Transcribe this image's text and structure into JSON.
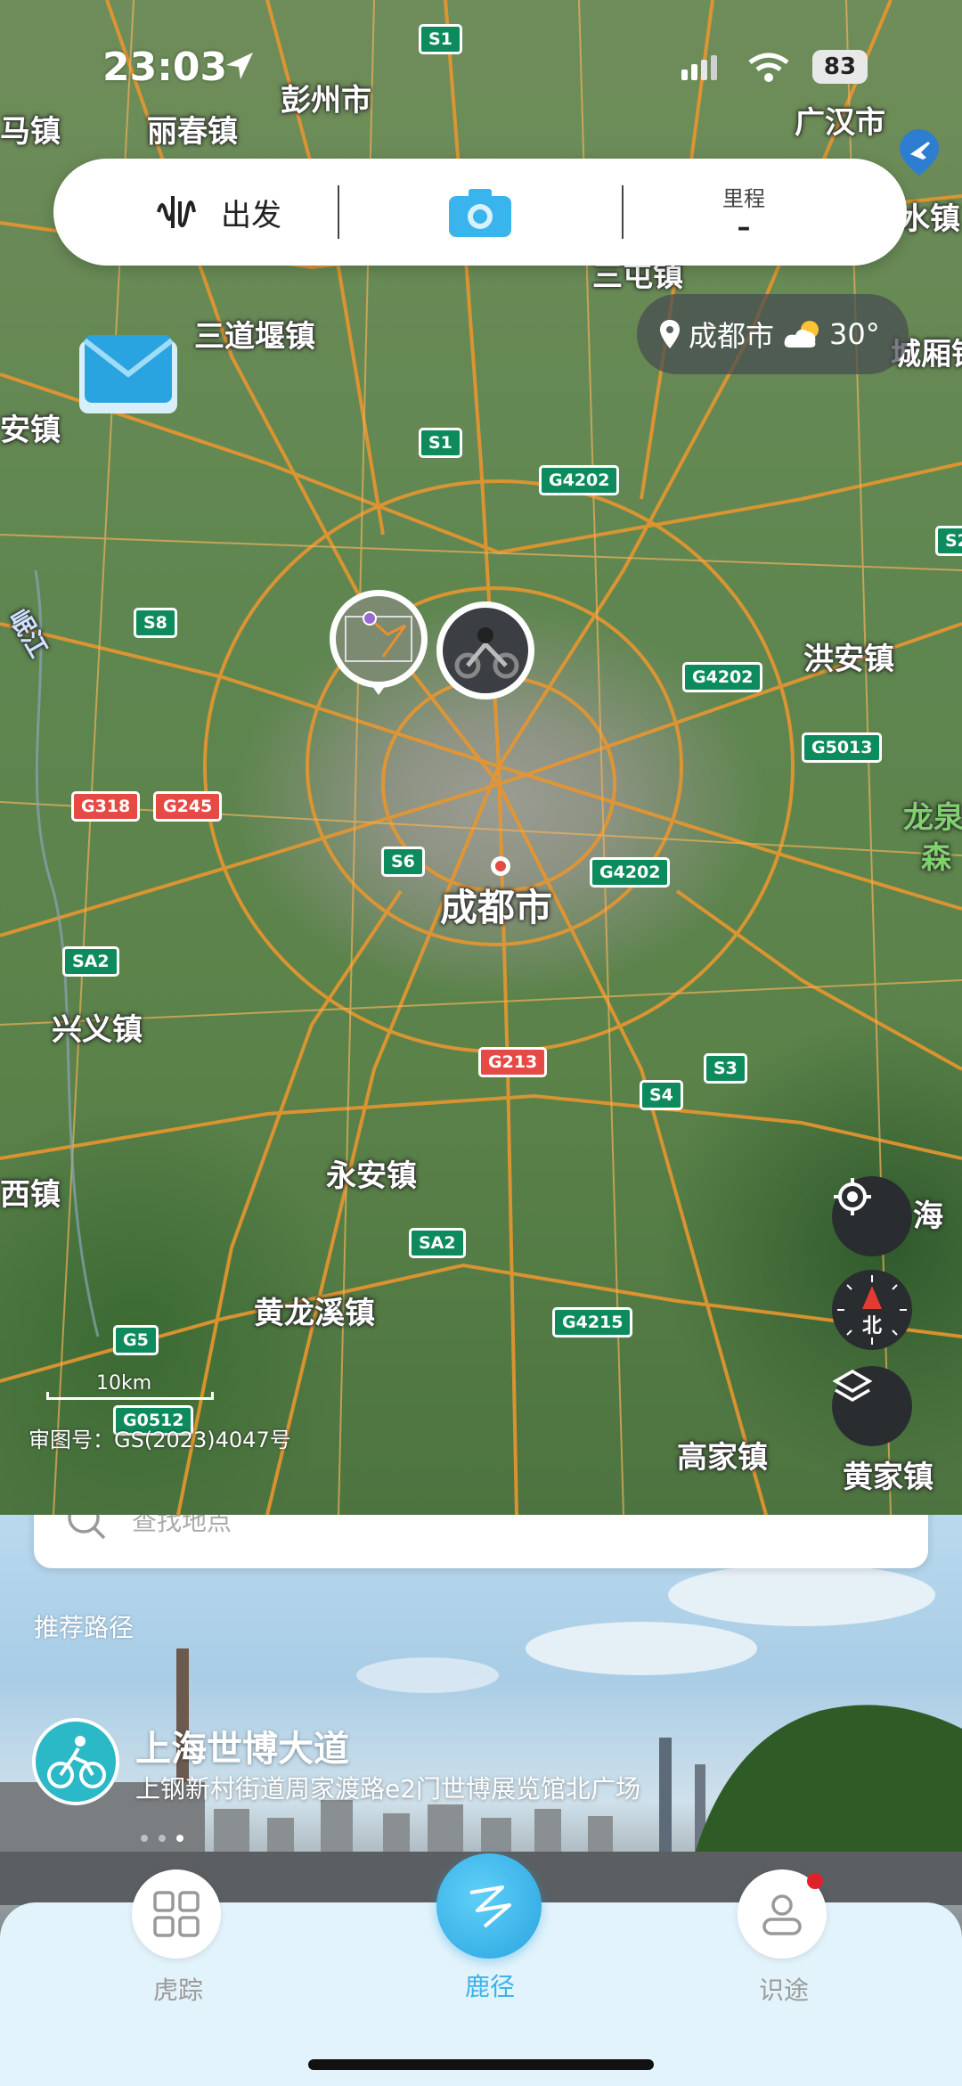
{
  "status_bar": {
    "time": "23:03",
    "battery": "83"
  },
  "top_bar": {
    "start_label": "出发",
    "mileage_label": "里程",
    "mileage_value": "–"
  },
  "weather": {
    "city": "成都市",
    "temperature": "30°"
  },
  "map": {
    "places": [
      {
        "name": "彭州市",
        "cls": ""
      },
      {
        "name": "丽春镇",
        "cls": ""
      },
      {
        "name": "马镇",
        "cls": ""
      },
      {
        "name": "广汉市",
        "cls": ""
      },
      {
        "name": "三道堰镇",
        "cls": ""
      },
      {
        "name": "安镇",
        "cls": ""
      },
      {
        "name": "城厢镇",
        "cls": ""
      },
      {
        "name": "洪安镇",
        "cls": ""
      },
      {
        "name": "成都市",
        "cls": "big"
      },
      {
        "name": "兴义镇",
        "cls": ""
      },
      {
        "name": "永安镇",
        "cls": ""
      },
      {
        "name": "黄龙溪镇",
        "cls": ""
      },
      {
        "name": "高家镇",
        "cls": ""
      },
      {
        "name": "海",
        "cls": ""
      },
      {
        "name": "西镇",
        "cls": ""
      },
      {
        "name": "龙泉",
        "cls": ""
      },
      {
        "name": "森",
        "cls": ""
      },
      {
        "name": "黄家镇",
        "cls": ""
      },
      {
        "name": "水镇",
        "cls": ""
      },
      {
        "name": "三屯镇",
        "cls": ""
      },
      {
        "name": "岷江",
        "cls": ""
      }
    ],
    "shields": [
      {
        "code": "S1",
        "color": "g"
      },
      {
        "code": "S1",
        "color": "g"
      },
      {
        "code": "G4202",
        "color": "g"
      },
      {
        "code": "S8",
        "color": "g"
      },
      {
        "code": "G4202",
        "color": "g"
      },
      {
        "code": "G5013",
        "color": "g"
      },
      {
        "code": "G318",
        "color": "r"
      },
      {
        "code": "G245",
        "color": "r"
      },
      {
        "code": "S6",
        "color": "g"
      },
      {
        "code": "G4202",
        "color": "g"
      },
      {
        "code": "SA2",
        "color": "g"
      },
      {
        "code": "G213",
        "color": "r"
      },
      {
        "code": "S3",
        "color": "g"
      },
      {
        "code": "S4",
        "color": "g"
      },
      {
        "code": "SA2",
        "color": "g"
      },
      {
        "code": "G4215",
        "color": "g"
      },
      {
        "code": "G5",
        "color": "g"
      },
      {
        "code": "G0512",
        "color": "g"
      },
      {
        "code": "S2",
        "color": "g"
      }
    ],
    "scale_label": "10km",
    "approval_number": "审图号：GS(2023)4047号",
    "compass_label": "北"
  },
  "search": {
    "placeholder": "查找地点"
  },
  "recommend": {
    "section_label": "推荐路径",
    "route_title": "上海世博大道",
    "route_subtitle": "上钢新村街道周家渡路e2门世博展览馆北广场",
    "page_count": 3,
    "active_page": 3
  },
  "nav": {
    "tab1": "虎踪",
    "tab2": "鹿径",
    "tab3": "识途"
  },
  "colors": {
    "accent": "#3ab4ec",
    "road": "#e8962f",
    "highway": "#0e8b5c"
  }
}
